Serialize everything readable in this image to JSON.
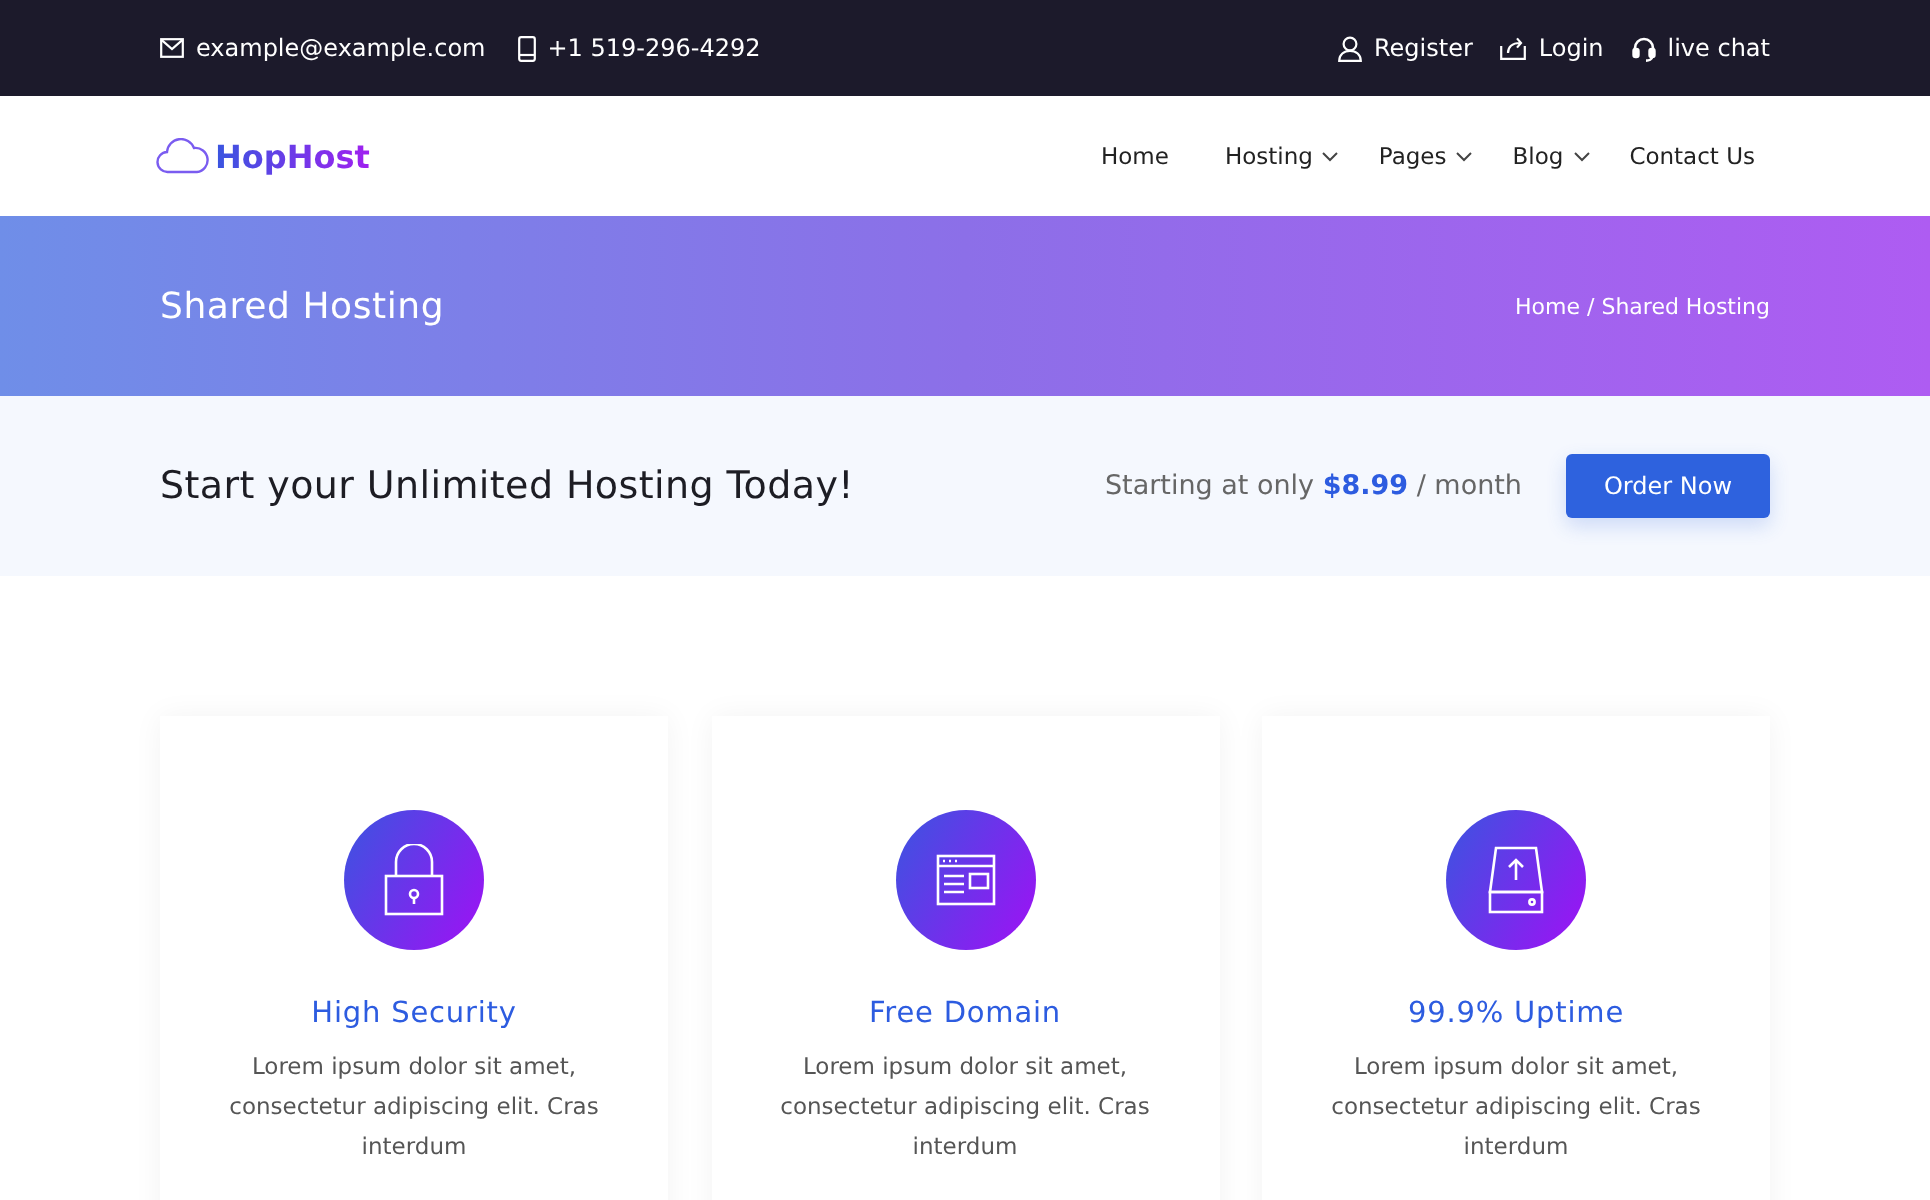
{
  "top_bar": {
    "contacts": [
      {
        "kind": "email",
        "text": "example@example.com"
      },
      {
        "kind": "phone",
        "text": "+1 519-296-4292"
      }
    ],
    "links": [
      {
        "kind": "user",
        "text": "Register"
      },
      {
        "kind": "login",
        "text": "Login"
      },
      {
        "kind": "chat",
        "text": "live chat"
      }
    ]
  },
  "nav": {
    "logo": "HopHost",
    "items": [
      {
        "label": "Home",
        "dropdown": false
      },
      {
        "label": "Hosting",
        "dropdown": true
      },
      {
        "label": "Pages",
        "dropdown": true
      },
      {
        "label": "Blog",
        "dropdown": true
      },
      {
        "label": "Contact Us",
        "dropdown": false
      }
    ]
  },
  "banner": {
    "title": "Shared Hosting",
    "breadcrumb": "Home / Shared Hosting"
  },
  "cta": {
    "headline": "Start your Unlimited Hosting Today!",
    "price_text": "Starting at only **$8.99** / month",
    "button": "Order Now"
  },
  "features": [
    {
      "kind": "lock",
      "title": "High Security",
      "text": "Lorem ipsum dolor sit amet, consectetur adipiscing elit. Cras interdum"
    },
    {
      "kind": "browser",
      "title": "Free Domain",
      "text": "Lorem ipsum dolor sit amet, consectetur adipiscing elit. Cras interdum"
    },
    {
      "kind": "drive",
      "title": "99.9% Uptime",
      "text": "Lorem ipsum dolor sit amet, consectetur adipiscing elit. Cras interdum"
    }
  ]
}
